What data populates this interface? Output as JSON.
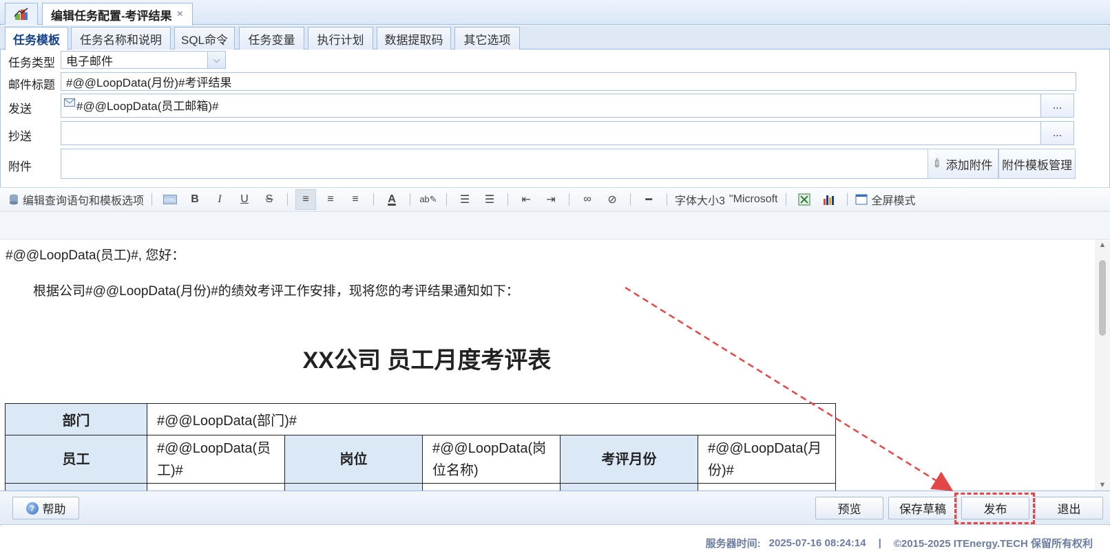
{
  "window": {
    "main_tab_title": "编辑任务配置-考评结果",
    "close_glyph": "×"
  },
  "subtabs": [
    {
      "label": "任务模板",
      "active": true
    },
    {
      "label": "任务名称和说明"
    },
    {
      "label": "SQL命令"
    },
    {
      "label": "任务变量"
    },
    {
      "label": "执行计划"
    },
    {
      "label": "数据提取码"
    },
    {
      "label": "其它选项"
    }
  ],
  "form": {
    "task_type_label": "任务类型",
    "task_type_value": "电子邮件",
    "subject_label": "邮件标题",
    "subject_value": "#@@LoopData(月份)#考评结果",
    "send_label": "发送",
    "send_value": "#@@LoopData(员工邮箱)#",
    "cc_label": "抄送",
    "cc_value": "",
    "attach_label": "附件",
    "dots": "...",
    "add_attachment": "添加附件",
    "attachment_template_mgmt": "附件模板管理"
  },
  "toolbar": {
    "edit_query": "编辑查询语句和模板选项",
    "bold": "B",
    "italic": "I",
    "underline": "U",
    "strike": "S",
    "font_color": "A",
    "font_size": "字体大小3",
    "font_name": "\"Microsoft",
    "fullscreen": "全屏模式"
  },
  "editor": {
    "greeting": "#@@LoopData(员工)#, 您好：",
    "paragraph": "根据公司#@@LoopData(月份)#的绩效考评工作安排，现将您的考评结果通知如下：",
    "doc_title": "XX公司 员工月度考评表",
    "table": {
      "dept_label": "部门",
      "dept_value": "#@@LoopData(部门)#",
      "employee_label": "员工",
      "employee_value": "#@@LoopData(员工)#",
      "position_label": "岗位",
      "position_value": "#@@LoopData(岗位名称)",
      "month_label": "考评月份",
      "month_value": "#@@LoopData(月份)#"
    }
  },
  "bottombar": {
    "help": "帮助",
    "preview": "预览",
    "save_draft": "保存草稿",
    "publish": "发布",
    "exit": "退出"
  },
  "footer": {
    "server_time_label": "服务器时间:",
    "server_time_value": "2025-07-16 08:24:14",
    "divider": "|",
    "copyright": "©2015-2025 ITEnergy.TECH 保留所有权利"
  },
  "colors": {
    "accent": "#15428b",
    "border": "#99bbe8",
    "annotation": "#e24646"
  }
}
